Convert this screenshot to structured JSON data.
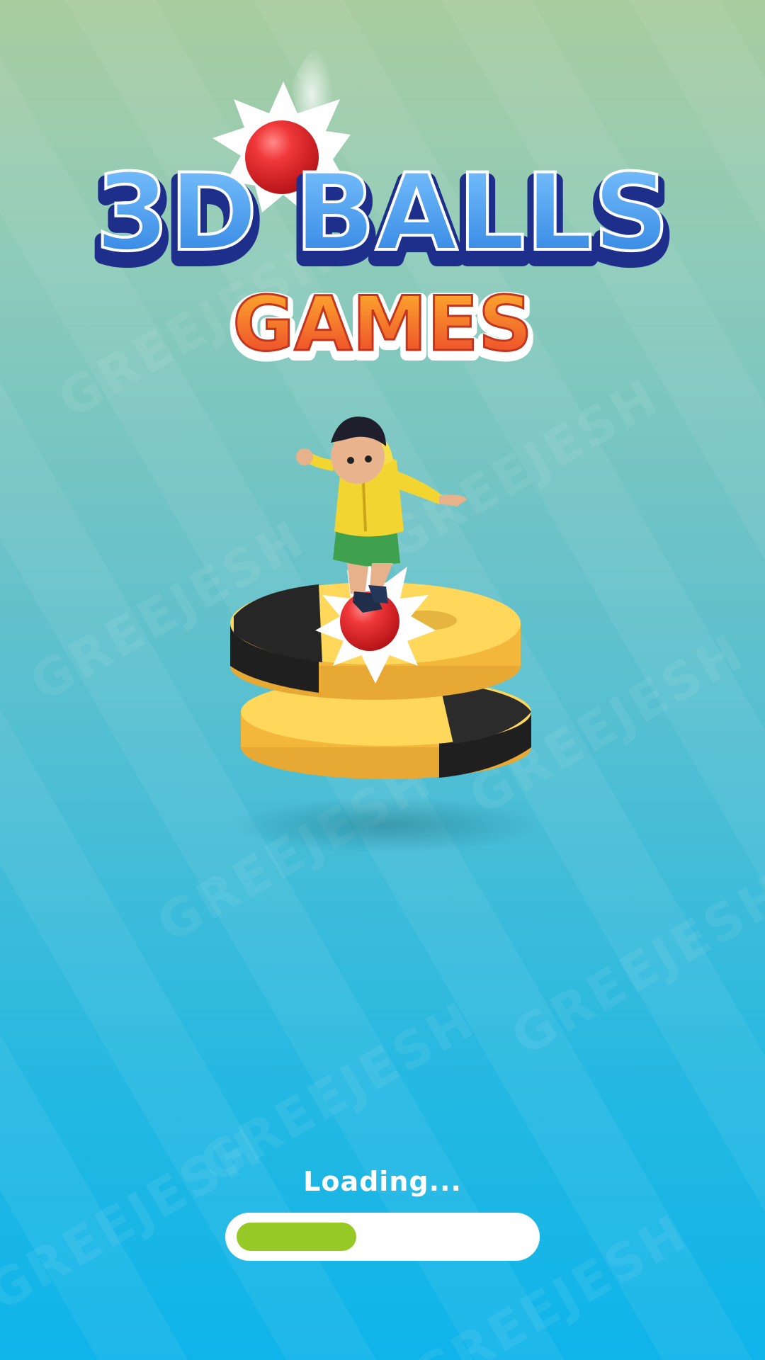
{
  "logo": {
    "line1": "3D BALLS",
    "line2": "GAMES"
  },
  "watermark": {
    "text": "GREEJESH"
  },
  "loading": {
    "label": "Loading...",
    "progress_fraction": 0.41
  },
  "colors": {
    "title_blue": "#3f9af0",
    "title_outline": "#1d2f8a",
    "games_orange": "#f06a2a",
    "ball_red": "#e3262a",
    "platform_yellow": "#f6c846",
    "platform_black": "#1f1f1f",
    "progress_green": "#97c926"
  }
}
